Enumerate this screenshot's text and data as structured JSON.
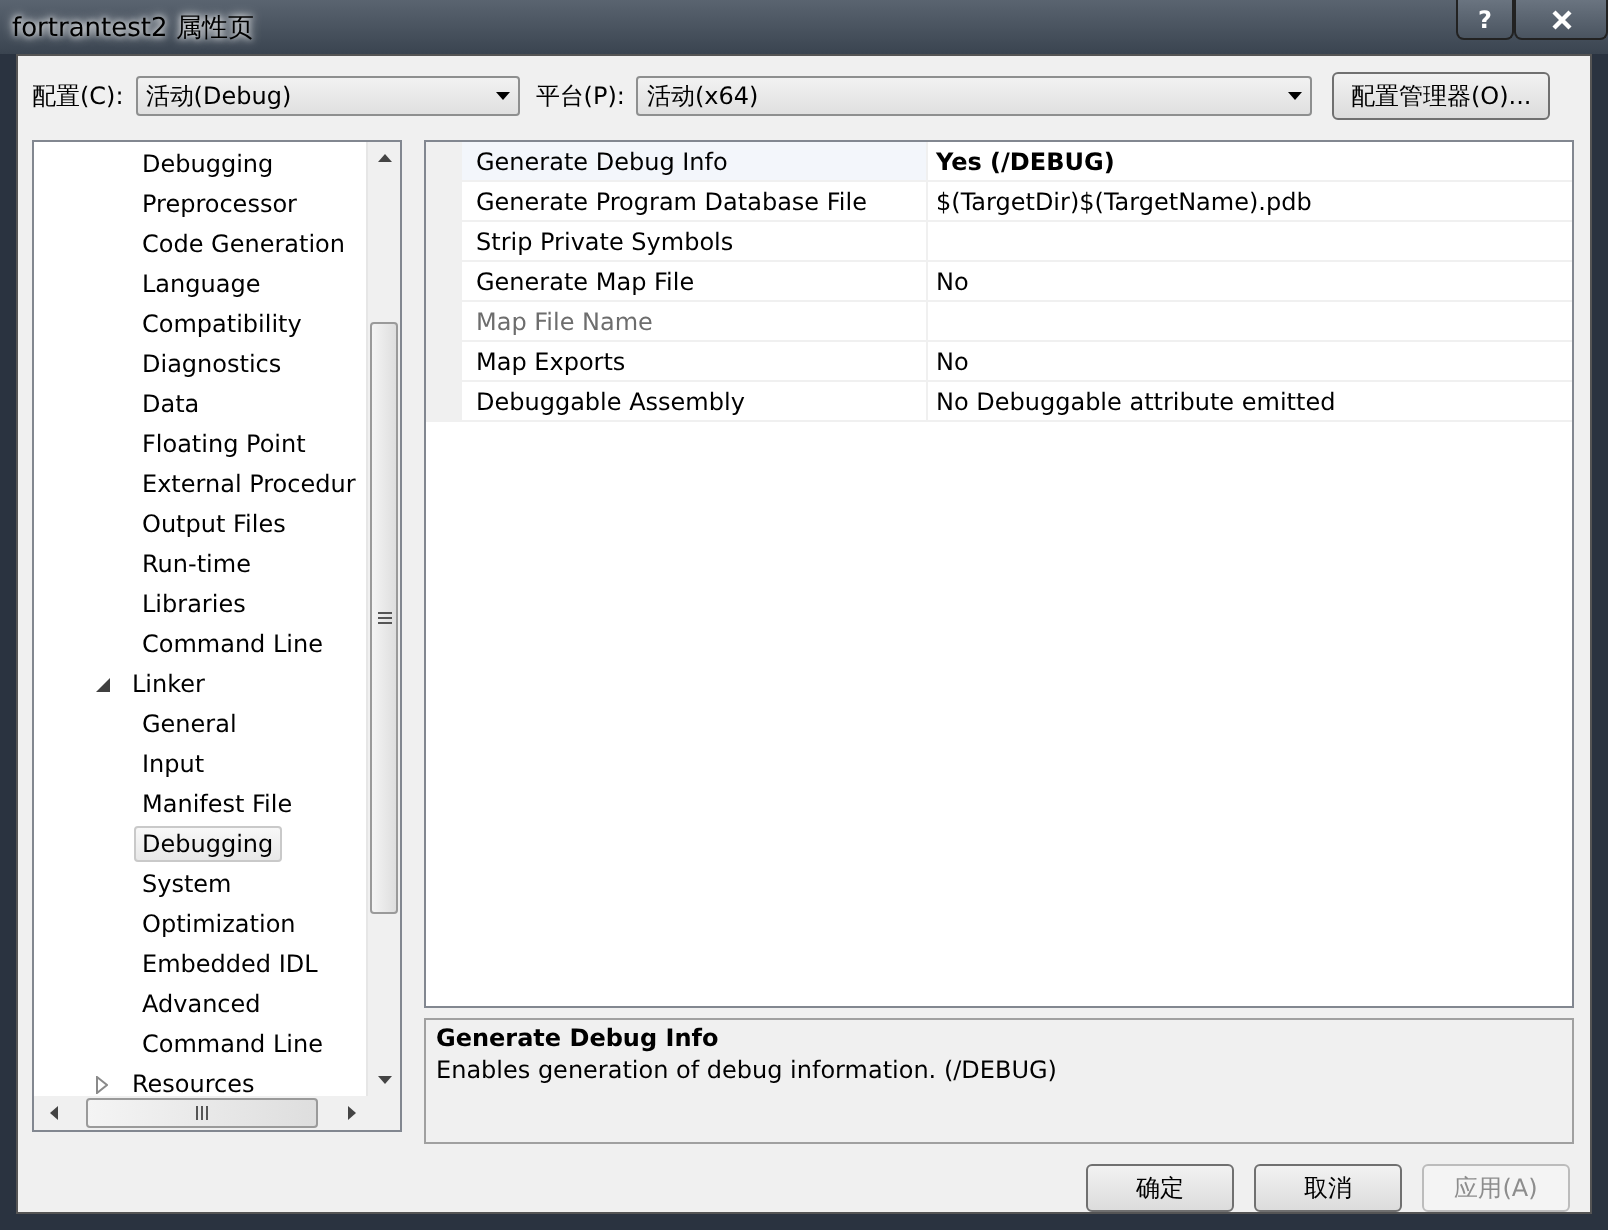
{
  "window": {
    "title": "fortrantest2 属性页",
    "help": "?"
  },
  "toolbar": {
    "configuration": {
      "label": "配置(C):",
      "value": "活动(Debug)"
    },
    "platform": {
      "label": "平台(P):",
      "value": "活动(x64)"
    },
    "manager_button": "配置管理器(O)..."
  },
  "tree": [
    {
      "children": [
        {
          "label": "Debugging",
          "selected": false
        },
        {
          "label": "Preprocessor",
          "selected": false
        },
        {
          "label": "Code Generation",
          "selected": false
        },
        {
          "label": "Language",
          "selected": false
        },
        {
          "label": "Compatibility",
          "selected": false
        },
        {
          "label": "Diagnostics",
          "selected": false
        },
        {
          "label": "Data",
          "selected": false
        },
        {
          "label": "Floating Point",
          "selected": false
        },
        {
          "label": "External Procedur",
          "selected": false
        },
        {
          "label": "Output Files",
          "selected": false
        },
        {
          "label": "Run-time",
          "selected": false
        },
        {
          "label": "Libraries",
          "selected": false
        },
        {
          "label": "Command Line",
          "selected": false
        }
      ]
    },
    {
      "label": "Linker",
      "selected": false,
      "expanded": true,
      "children": [
        {
          "label": "General",
          "selected": false
        },
        {
          "label": "Input",
          "selected": false
        },
        {
          "label": "Manifest File",
          "selected": false
        },
        {
          "label": "Debugging",
          "selected": true
        },
        {
          "label": "System",
          "selected": false
        },
        {
          "label": "Optimization",
          "selected": false
        },
        {
          "label": "Embedded IDL",
          "selected": false
        },
        {
          "label": "Advanced",
          "selected": false
        },
        {
          "label": "Command Line",
          "selected": false
        }
      ]
    },
    {
      "label": "Resources",
      "selected": false,
      "expanded": false
    }
  ],
  "properties": [
    {
      "name": "Generate Debug Info",
      "value": "Yes (/DEBUG)",
      "selected": true,
      "modified": true,
      "disabled": false
    },
    {
      "name": "Generate Program Database File",
      "value": "$(TargetDir)$(TargetName).pdb",
      "selected": false,
      "modified": false,
      "disabled": false
    },
    {
      "name": "Strip Private Symbols",
      "selected": false,
      "disabled": false
    },
    {
      "name": "Generate Map File",
      "value": "No",
      "selected": false,
      "modified": false,
      "disabled": false
    },
    {
      "name": "Map File Name",
      "selected": false,
      "disabled": true
    },
    {
      "name": "Map Exports",
      "value": "No",
      "selected": false,
      "modified": false,
      "disabled": false
    },
    {
      "name": "Debuggable Assembly",
      "value": "No Debuggable attribute emitted",
      "selected": false,
      "modified": false,
      "disabled": false
    }
  ],
  "description": {
    "title": "Generate Debug Info",
    "text": "Enables generation of debug information. (/DEBUG)"
  },
  "buttons": [
    {
      "label": "确定",
      "disabled": false
    },
    {
      "label": "取消",
      "disabled": false
    },
    {
      "label": "应用(A)",
      "disabled": true
    }
  ]
}
